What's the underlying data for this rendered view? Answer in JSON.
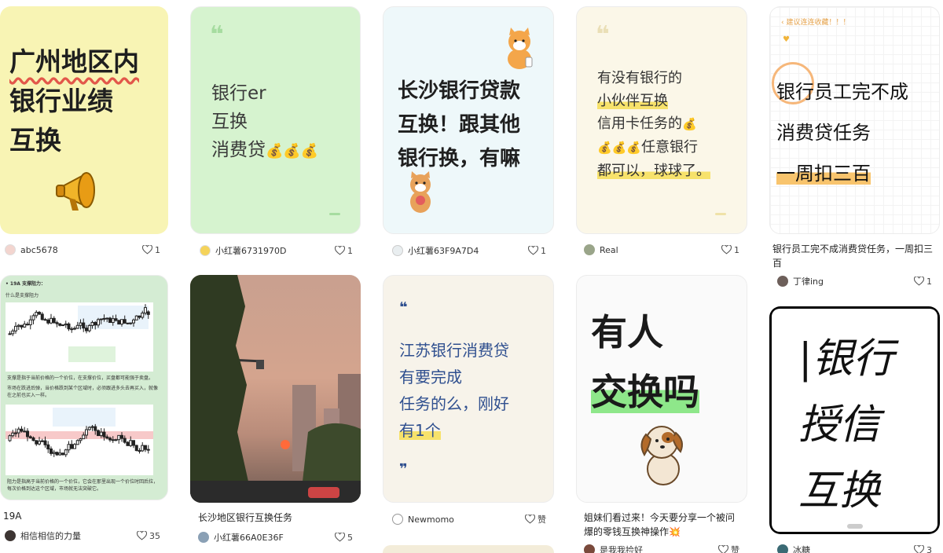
{
  "cards": [
    {
      "id": "c1",
      "cover_lines": [
        "广州地区内",
        "银行业绩",
        "互换"
      ],
      "author": "abc5678",
      "likes": "1"
    },
    {
      "id": "c2",
      "cover_lines": [
        "银行er",
        "互换",
        "消费贷"
      ],
      "author": "小红薯6731970D",
      "likes": "1"
    },
    {
      "id": "c3",
      "cover_lines": [
        "长沙银行贷款",
        "互换！跟其他",
        "银行换，有嘛"
      ],
      "author": "小红薯63F9A7D4",
      "likes": "1"
    },
    {
      "id": "c4",
      "cover_lines": [
        "有没有银行的",
        "小伙伴互换",
        "信用卡任务的",
        "任意银行",
        "都可以，球球了。"
      ],
      "author": "Real",
      "likes": "1"
    },
    {
      "id": "c5",
      "top_note": "建议连连收藏！！！",
      "cover_lines": [
        "银行员工完不成",
        "消费贷任务",
        "一周扣三百"
      ],
      "caption": "银行员工完不成消费贷任务，一周扣三百",
      "author": "丁律ing",
      "likes": "1"
    },
    {
      "id": "c6",
      "cover_lines": [
        "• 19A  支撑阻力：",
        "什么是支撑阻力",
        "支撑是指于当前价格的一个价位，在支撑价位，买盘都可能强于卖盘。",
        "市场在跌进后弹，当价格跌到某个区域时，必须跟进多头去再买入，就像在之前也买入一样。",
        "阻力是指高于当前价格的一个价位，它会在那里出现一个价位时回后拉，每次价格到达这个区域，市场就无法突破它。"
      ],
      "caption": "19A",
      "author": "相信相信的力量",
      "likes": "35"
    },
    {
      "id": "c7",
      "caption": "长沙地区银行互换任务",
      "author": "小红薯66A0E36F",
      "likes": "5"
    },
    {
      "id": "c8",
      "cover_lines": [
        "江苏银行消费贷",
        "有要完成",
        "任务的么，刚好",
        "有1个"
      ],
      "author": "Newmomo",
      "likes": "赞"
    },
    {
      "id": "c9",
      "cover_lines": [
        "有人",
        "交换吗"
      ],
      "caption": "姐妹们看过来！今天要分享一个被问爆的零钱互换神操作💥",
      "author": "是我我捡好",
      "likes": "赞"
    },
    {
      "id": "c10",
      "cover_lines": [
        "|银行",
        "授信",
        "互换"
      ],
      "author": "冰糖",
      "likes": "3"
    }
  ],
  "colors": {
    "c1_bg": "#f8f4b4",
    "c2_bg": "#d6f3cf",
    "c3_bg": "#eef8fa",
    "c4_bg": "#fbf7e8",
    "c8_bg": "#f7f3ea",
    "c6_bg": "#d4ecd3"
  }
}
